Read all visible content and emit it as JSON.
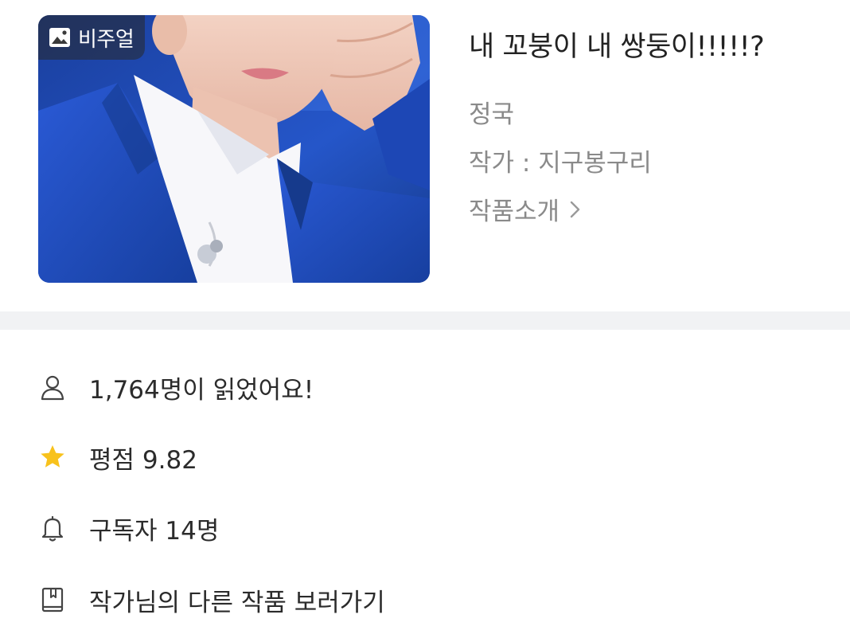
{
  "cover": {
    "badge_label": "비주얼",
    "badge_icon": "image-icon"
  },
  "work": {
    "title": "내 꼬붕이 내 쌍둥이!!!!!?",
    "genre": "정국",
    "author": "작가 : 지구봉구리",
    "intro_label": "작품소개"
  },
  "stats": {
    "readers": "1,764명이 읽었어요!",
    "rating": "평점 9.82",
    "subscribers": "구독자 14명",
    "other_works": "작가님의 다른 작품 보러가기"
  },
  "colors": {
    "star": "#f8c21c",
    "muted_text": "#8a8a8a",
    "band": "#f1f2f4",
    "jacket_blue": "#1f4fc4"
  }
}
